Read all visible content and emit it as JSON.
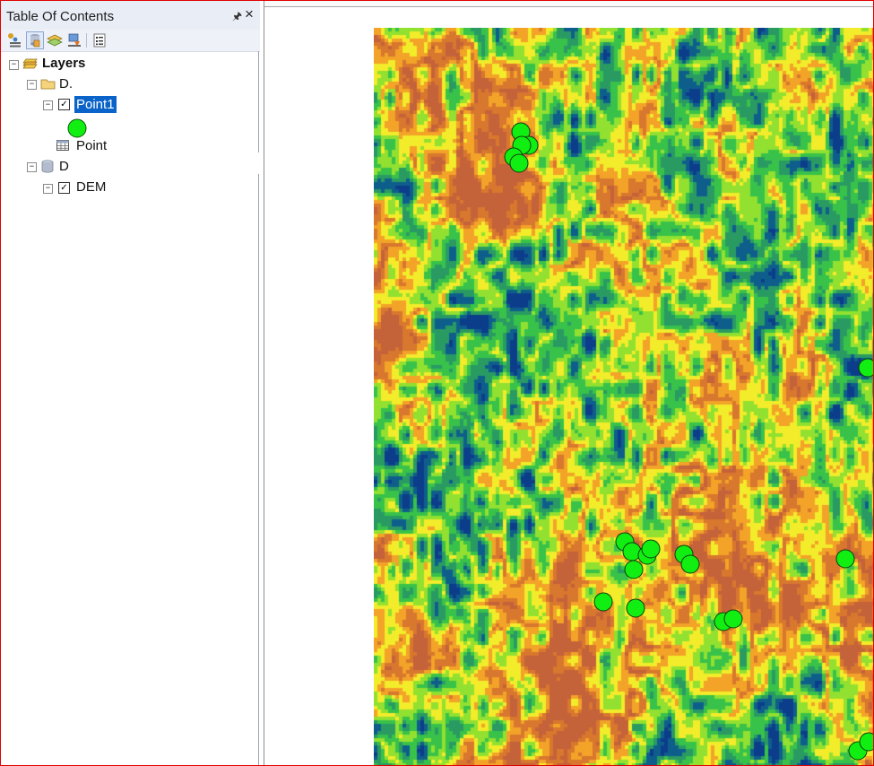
{
  "toc": {
    "title": "Table Of Contents",
    "pin_icon": "pin-icon",
    "close_label": "×",
    "toolbar": [
      {
        "name": "list-by-drawing-order-button",
        "icon": "layers-stack-icon"
      },
      {
        "name": "list-by-source-button",
        "icon": "database-icon"
      },
      {
        "name": "list-by-visibility-button",
        "icon": "visibility-layers-icon"
      },
      {
        "name": "list-by-selection-button",
        "icon": "selection-icon"
      },
      {
        "name": "options-button",
        "icon": "options-icon"
      }
    ],
    "tree": {
      "root_label": "Layers",
      "folder_label": "D.",
      "point_layer_label": "Point1",
      "point_table_label": "Point",
      "db_label": "D",
      "dem_label": "DEM",
      "point1_checked": true,
      "dem_checked": true
    }
  },
  "map": {
    "symbol_color": "#11ee11",
    "dem_palette": [
      "#0c3d8a",
      "#0e5e8c",
      "#2a9a63",
      "#38c24a",
      "#92e030",
      "#f2ec2a",
      "#f2a328",
      "#d8772e",
      "#c4623a"
    ]
  }
}
